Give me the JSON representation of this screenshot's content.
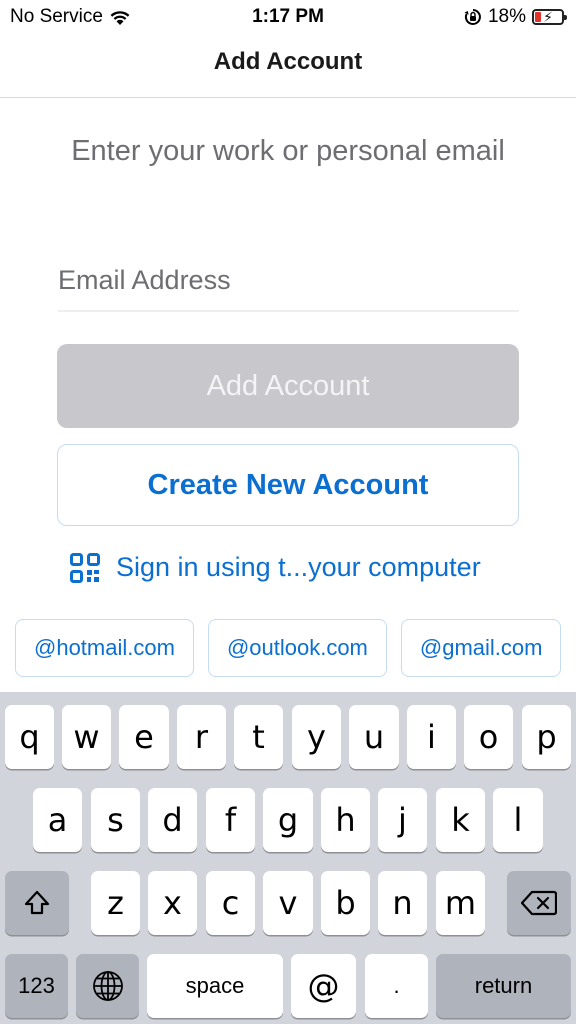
{
  "status_bar": {
    "carrier": "No Service",
    "time": "1:17 PM",
    "battery": "18%",
    "icons": [
      "wifi-icon",
      "orientation-lock-icon",
      "battery-icon"
    ]
  },
  "nav": {
    "title": "Add Account"
  },
  "prompt": "Enter your work or personal email",
  "email": {
    "placeholder": "Email Address",
    "value": ""
  },
  "buttons": {
    "add_account": "Add Account",
    "create_account": "Create New Account"
  },
  "qr_signin": {
    "label": "Sign in using t...your computer",
    "icon": "qr-code-icon"
  },
  "domain_suggestions": [
    "@hotmail.com",
    "@outlook.com",
    "@gmail.com"
  ],
  "keyboard": {
    "row1": [
      "q",
      "w",
      "e",
      "r",
      "t",
      "y",
      "u",
      "i",
      "o",
      "p"
    ],
    "row2": [
      "a",
      "s",
      "d",
      "f",
      "g",
      "h",
      "j",
      "k",
      "l"
    ],
    "row3": [
      "z",
      "x",
      "c",
      "v",
      "b",
      "n",
      "m"
    ],
    "numbers_key": "123",
    "space_key": "space",
    "at_key": "@",
    "dot_key": ".",
    "return_key": "return"
  },
  "colors": {
    "accent": "#0a6fd1",
    "disabled_button": "#c7c7cc",
    "keyboard_bg": "#d1d4da"
  }
}
